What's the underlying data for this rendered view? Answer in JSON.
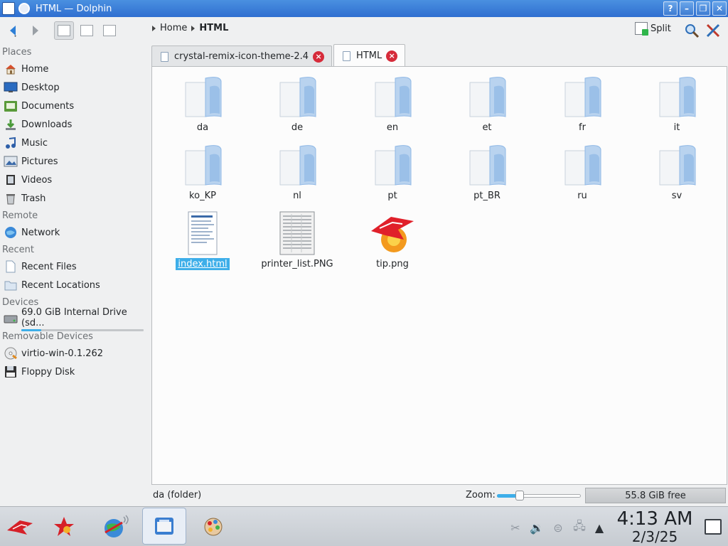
{
  "window": {
    "title": "HTML — Dolphin"
  },
  "titlebar_buttons": {
    "help": "?",
    "minimize": "–",
    "maximize": "❐",
    "close": "✕"
  },
  "toolbar": {
    "breadcrumb": [
      "Home",
      "HTML"
    ],
    "split_label": "Split"
  },
  "places": {
    "sections": [
      {
        "heading": "Places",
        "items": [
          {
            "label": "Home",
            "icon": "home-icon"
          },
          {
            "label": "Desktop",
            "icon": "desktop-icon"
          },
          {
            "label": "Documents",
            "icon": "documents-icon"
          },
          {
            "label": "Downloads",
            "icon": "downloads-icon"
          },
          {
            "label": "Music",
            "icon": "music-icon"
          },
          {
            "label": "Pictures",
            "icon": "pictures-icon"
          },
          {
            "label": "Videos",
            "icon": "videos-icon"
          },
          {
            "label": "Trash",
            "icon": "trash-icon"
          }
        ]
      },
      {
        "heading": "Remote",
        "items": [
          {
            "label": "Network",
            "icon": "network-icon"
          }
        ]
      },
      {
        "heading": "Recent",
        "items": [
          {
            "label": "Recent Files",
            "icon": "recent-files-icon"
          },
          {
            "label": "Recent Locations",
            "icon": "recent-locations-icon"
          }
        ]
      },
      {
        "heading": "Devices",
        "items": [
          {
            "label": "69.0 GiB Internal Drive (sd...",
            "icon": "harddrive-icon",
            "usage": 0.16
          }
        ]
      },
      {
        "heading": "Removable Devices",
        "items": [
          {
            "label": "virtio-win-0.1.262",
            "icon": "optical-disc-icon"
          },
          {
            "label": "Floppy Disk",
            "icon": "floppy-icon"
          }
        ]
      }
    ]
  },
  "tabs": [
    {
      "label": "crystal-remix-icon-theme-2.4",
      "active": false
    },
    {
      "label": "HTML",
      "active": true
    }
  ],
  "files": [
    {
      "name": "da",
      "type": "folder",
      "selected": false
    },
    {
      "name": "de",
      "type": "folder",
      "selected": false
    },
    {
      "name": "en",
      "type": "folder",
      "selected": false
    },
    {
      "name": "et",
      "type": "folder",
      "selected": false
    },
    {
      "name": "fr",
      "type": "folder",
      "selected": false
    },
    {
      "name": "it",
      "type": "folder",
      "selected": false
    },
    {
      "name": "ko_KP",
      "type": "folder",
      "selected": false
    },
    {
      "name": "nl",
      "type": "folder",
      "selected": false
    },
    {
      "name": "pt",
      "type": "folder",
      "selected": false
    },
    {
      "name": "pt_BR",
      "type": "folder",
      "selected": false
    },
    {
      "name": "ru",
      "type": "folder",
      "selected": false
    },
    {
      "name": "sv",
      "type": "folder",
      "selected": false
    },
    {
      "name": "index.html",
      "type": "html",
      "selected": true
    },
    {
      "name": "printer_list.PNG",
      "type": "image-png",
      "selected": false
    },
    {
      "name": "tip.png",
      "type": "image-tip",
      "selected": false
    }
  ],
  "statusbar": {
    "text": "da (folder)",
    "zoom_label": "Zoom:",
    "zoom_level": 0.27,
    "free_space": "55.8 GiB free"
  },
  "taskbar": {
    "clock_time": "4:13 AM",
    "clock_date": "2/3/25"
  },
  "colors": {
    "accent": "#3daee9",
    "titlebar": "#2f6fd0",
    "close_badge": "#d62b3a",
    "folder_blue": "#8fb8e6"
  }
}
